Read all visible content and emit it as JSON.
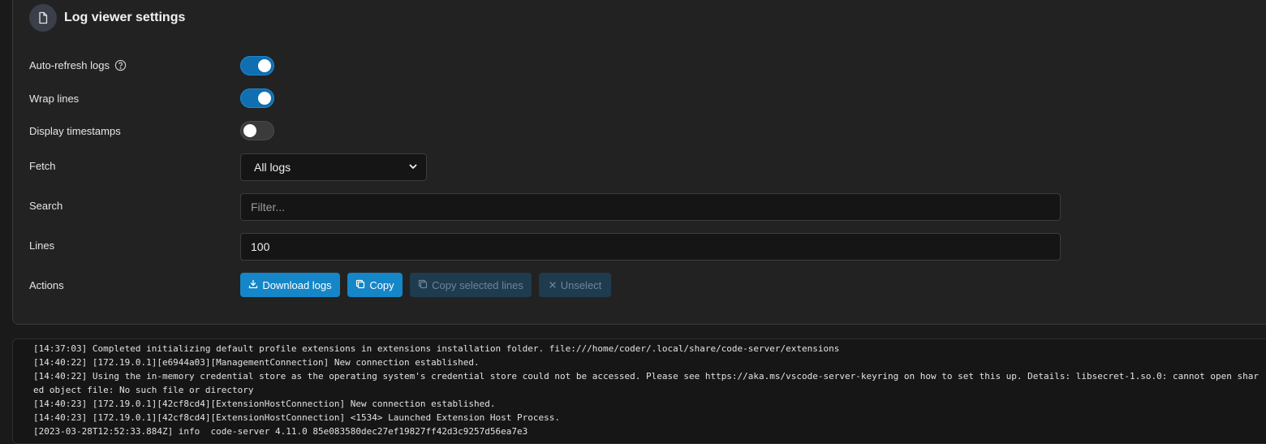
{
  "header": {
    "title": "Log viewer settings",
    "icon": "file-icon"
  },
  "settings": {
    "auto_refresh": {
      "label": "Auto-refresh logs",
      "enabled": true
    },
    "wrap_lines": {
      "label": "Wrap lines",
      "enabled": true
    },
    "display_timestamps": {
      "label": "Display timestamps",
      "enabled": false
    },
    "fetch": {
      "label": "Fetch",
      "value": "All logs"
    },
    "search": {
      "label": "Search",
      "value": "",
      "placeholder": "Filter..."
    },
    "lines": {
      "label": "Lines",
      "value": "100"
    },
    "actions": {
      "label": "Actions"
    }
  },
  "buttons": {
    "download": "Download logs",
    "copy": "Copy",
    "copy_selected": "Copy selected lines",
    "unselect": "Unselect"
  },
  "log_lines": [
    "[14:37:03] Completed initializing default profile extensions in extensions installation folder. file:///home/coder/.local/share/code-server/extensions",
    "[14:40:22] [172.19.0.1][e6944a03][ManagementConnection] New connection established.",
    "[14:40:22] Using the in-memory credential store as the operating system's credential store could not be accessed. Please see https://aka.ms/vscode-server-keyring on how to set this up. Details: libsecret-1.so.0: cannot open shared object file: No such file or directory",
    "[14:40:23] [172.19.0.1][42cf8cd4][ExtensionHostConnection] New connection established.",
    "[14:40:23] [172.19.0.1][42cf8cd4][ExtensionHostConnection] <1534> Launched Extension Host Process.",
    "[2023-03-28T12:52:33.884Z] info  code-server 4.11.0 85e083580dec27ef19827ff42d3c9257d56ea7e3"
  ],
  "colors": {
    "accent": "#1586c8",
    "toggle_on": "#0f6fb0",
    "background": "#222222"
  }
}
